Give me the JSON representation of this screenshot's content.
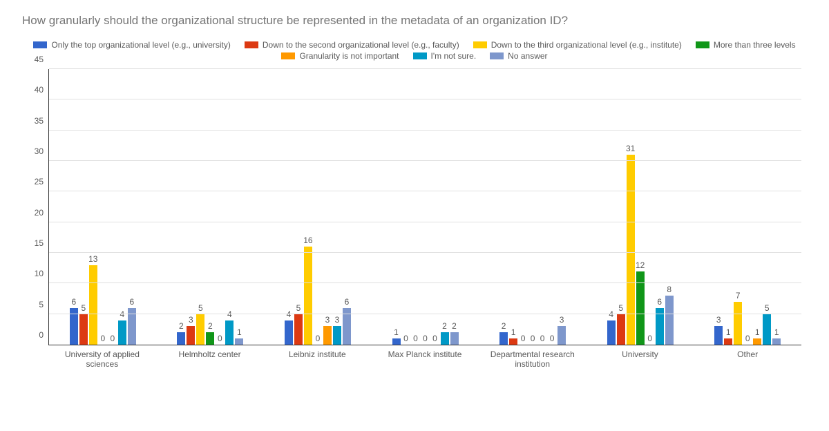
{
  "chart_data": {
    "type": "bar",
    "title": "How granularly should the organizational structure be represented in the metadata of an organization ID?",
    "ylabel": "",
    "xlabel": "",
    "ylim": [
      0,
      45
    ],
    "y_ticks": [
      0,
      5,
      10,
      15,
      20,
      25,
      30,
      35,
      40,
      45
    ],
    "categories": [
      "University of applied sciences",
      "Helmholtz center",
      "Leibniz institute",
      "Max Planck institute",
      "Departmental research institution",
      "University",
      "Other"
    ],
    "series": [
      {
        "name": "Only the top organizational level (e.g., university)",
        "color": "#3366CC",
        "values": [
          6,
          2,
          4,
          1,
          2,
          4,
          3
        ]
      },
      {
        "name": "Down to the second organizational level (e.g., faculty)",
        "color": "#DC3912",
        "values": [
          5,
          3,
          5,
          0,
          1,
          5,
          1
        ]
      },
      {
        "name": "Down to the third organizational level (e.g., institute)",
        "color": "#FFCC00",
        "values": [
          13,
          5,
          16,
          0,
          0,
          31,
          7
        ]
      },
      {
        "name": "More than three levels",
        "color": "#109618",
        "values": [
          0,
          2,
          0,
          0,
          0,
          12,
          0
        ]
      },
      {
        "name": "Granularity is not important",
        "color": "#FF9900",
        "values": [
          0,
          0,
          3,
          0,
          0,
          0,
          1
        ]
      },
      {
        "name": "I'm not sure.",
        "color": "#0099C6",
        "values": [
          4,
          4,
          3,
          2,
          0,
          6,
          5
        ]
      },
      {
        "name": "No answer",
        "color": "#7E97CC",
        "values": [
          6,
          1,
          6,
          2,
          3,
          8,
          1
        ]
      }
    ],
    "legend_rows": [
      [
        0,
        1,
        2,
        3
      ],
      [
        4,
        5,
        6
      ]
    ]
  }
}
